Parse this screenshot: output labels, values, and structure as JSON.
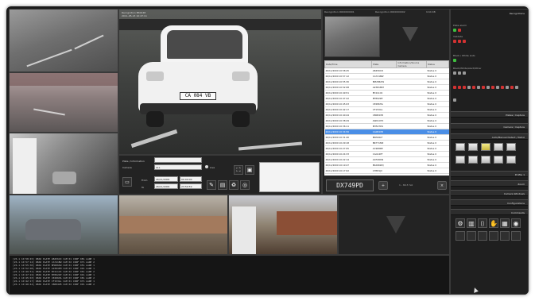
{
  "main_view": {
    "overlay_line1": "Recognition PR0048",
    "overlay_line2": "2011-05-13 10:47:11",
    "plate_on_car": "CA 084 VB"
  },
  "bottom_right_panel": {
    "header_left": "Recognition 0000000001",
    "header_mid": "Recognition 0000000002",
    "header_right": "9.64 KB"
  },
  "events_table": {
    "columns": [
      "Date/Time",
      "Plate",
      "Information/Source Camera",
      "Status"
    ],
    "rows": [
      [
        "26/11/2009 10:58:45",
        "AB456CD",
        "",
        "Status 0"
      ],
      [
        "26/11/2009 10:57:12",
        "CA741BW",
        "",
        "Status 0"
      ],
      [
        "26/11/2009 10:55:30",
        "BM286XW",
        "",
        "Status 0"
      ],
      [
        "26/11/2009 10:52:08",
        "AZ381MM",
        "",
        "Status 0"
      ],
      [
        "26/11/2009 10:49:51",
        "BY411CK",
        "",
        "Status 0"
      ],
      [
        "26/11/2009 10:47:22",
        "BT892ZP",
        "",
        "Status 0"
      ],
      [
        "26/11/2009 10:45:03",
        "CE286HA",
        "",
        "Status 0"
      ],
      [
        "26/11/2009 10:42:17",
        "CF153GL",
        "",
        "Status 0"
      ],
      [
        "26/11/2009 10:40:44",
        "CB084VB",
        "",
        "Status 0"
      ],
      [
        "26/11/2009 10:38:29",
        "AW614TX",
        "",
        "Status 0"
      ],
      [
        "26/11/2009 10:36:11",
        "BH547DS",
        "",
        "Status 0"
      ],
      [
        "26/11/2009 10:34:56",
        "CA084VB",
        "",
        "Status 0"
      ],
      [
        "26/11/2009 10:31:40",
        "BN326LF",
        "",
        "Status 0"
      ],
      [
        "26/11/2009 10:29:18",
        "BR771MZ",
        "",
        "Status 0"
      ],
      [
        "26/11/2009 10:27:05",
        "AC908RE",
        "",
        "Status 0"
      ],
      [
        "26/11/2009 10:24:33",
        "CG412PT",
        "",
        "Status 0"
      ],
      [
        "26/11/2009 10:22:14",
        "AD530KN",
        "",
        "Status 0"
      ],
      [
        "26/11/2009 10:19:47",
        "BS266WQ",
        "",
        "Status 0"
      ],
      [
        "26/11/2009 10:17:02",
        "CH831JX",
        "",
        "Status 0"
      ]
    ],
    "selected_index": 11
  },
  "plate_display": {
    "plate": "DX749PD",
    "info": "1 - 89.5 %0"
  },
  "search": {
    "plate_label": "Plate / Information",
    "camera_label": "Camera",
    "camera_value": "ALL",
    "from_label": "From",
    "to_label": "To",
    "from_date": "26/11/2009",
    "from_time": "00:00:00",
    "to_date": "26/11/2009",
    "to_time": "23:59:59",
    "live_label": "Live"
  },
  "sidebar": {
    "title": "Recognitions",
    "sections": [
      {
        "label": "Plates / Capture"
      },
      {
        "label": "Camera / Capture"
      },
      {
        "label": "Auto/Manual Detect / Patrol"
      },
      {
        "label": "Profile 1"
      },
      {
        "label": "Zoom"
      },
      {
        "label": "Camera Windows"
      },
      {
        "label": "Configurations"
      },
      {
        "label": "Commands"
      }
    ],
    "status_label1": "Plate alarm",
    "status_label2": "Validate",
    "status_label3": "Black / White Lists",
    "status_label4": "Black/White/Alert/Other"
  },
  "log": {
    "lines": [
      "[26.1 10:58:45] READ PLATE AB456CD  CAM 01  CONF 98%  LANE 1",
      "[26.1 10:57:12] READ PLATE CA741BW  CAM 02  CONF 97%  LANE 2",
      "[26.1 10:55:30] READ PLATE BM286XW  CAM 01  CONF 95%  LANE 1",
      "[26.1 10:52:08] READ PLATE AZ381MM  CAM 03  CONF 99%  LANE 1",
      "[26.1 10:49:51] READ PLATE BY411CK  CAM 02  CONF 96%  LANE 2",
      "[26.1 10:47:22] READ PLATE BT892ZP  CAM 01  CONF 94%  LANE 1",
      "[26.1 10:45:03] READ PLATE CE286HA  CAM 03  CONF 98%  LANE 2",
      "[26.1 10:42:17] READ PLATE CF153GL  CAM 01  CONF 97%  LANE 1",
      "[26.1 10:40:44] READ PLATE CB084VB  CAM 02  CONF 99%  LANE 2"
    ]
  },
  "colors": {
    "selected_row": "#4a8ee6",
    "status_green": "#3fbf3f",
    "status_red": "#d23232",
    "status_gray": "#9a9a9a"
  }
}
